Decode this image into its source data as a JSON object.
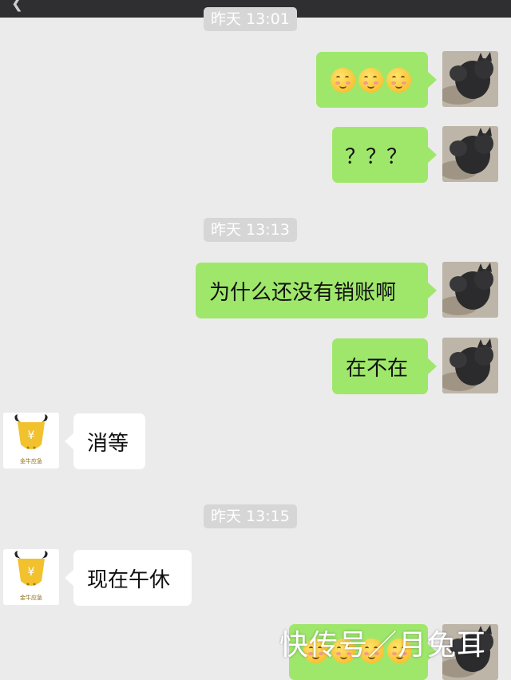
{
  "header": {
    "back_glyph": "❮",
    "title": ""
  },
  "timestamps": [
    "昨天 13:01",
    "昨天 13:13",
    "昨天 13:15"
  ],
  "messages": [
    {
      "side": "me",
      "type": "emoji",
      "emoji": [
        "smiling-blushing-face",
        "smiling-blushing-face",
        "smiling-blushing-face"
      ]
    },
    {
      "side": "me",
      "text": "？？？"
    },
    {
      "side": "me",
      "text": "为什么还没有销账啊"
    },
    {
      "side": "me",
      "text": "在不在"
    },
    {
      "side": "them",
      "text": "消等"
    },
    {
      "side": "them",
      "text": "现在午休"
    },
    {
      "side": "me",
      "type": "emoji",
      "emoji": [
        "smiling-blushing-face",
        "smiling-blushing-face",
        "smiling-blushing-face",
        "smiling-blushing-face"
      ]
    }
  ],
  "avatars": {
    "me": "black-cat-photo",
    "them": "gold-bull-coin-logo",
    "them_caption": "金牛应急"
  },
  "watermark": "快传号／月兔耳",
  "colors": {
    "background": "#ebebeb",
    "my_bubble": "#9fe76b",
    "their_bubble": "#ffffff",
    "timestamp_pill": "#d6d6d6"
  }
}
